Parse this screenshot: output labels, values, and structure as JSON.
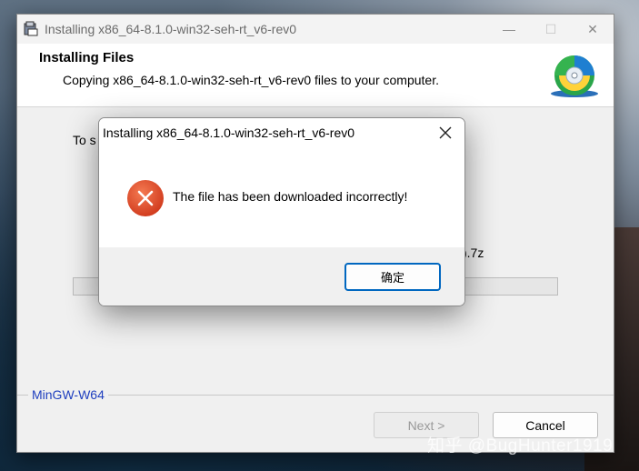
{
  "installer": {
    "window_title": "Installing x86_64-8.1.0-win32-seh-rt_v6-rev0",
    "header_title": "Installing Files",
    "header_subtitle": "Copying x86_64-8.1.0-win32-seh-rt_v6-rev0 files to your computer.",
    "partial_label": "To s",
    "partial_filename": ").7z",
    "progress_fraction": 0.0,
    "brand": "MinGW-W64",
    "next_label": "Next >",
    "cancel_label": "Cancel",
    "minimize_glyph": "—",
    "maximize_glyph": "☐",
    "close_glyph": "✕"
  },
  "dialog": {
    "title": "Installing x86_64-8.1.0-win32-seh-rt_v6-rev0",
    "message": "The file has been downloaded incorrectly!",
    "ok_label": "确定",
    "icon": "error-icon",
    "error_color": "#e0452a"
  },
  "watermark": "知乎 @BugHunter1919",
  "colors": {
    "accent": "#0067c0",
    "brand_text": "#1f3fbf"
  }
}
